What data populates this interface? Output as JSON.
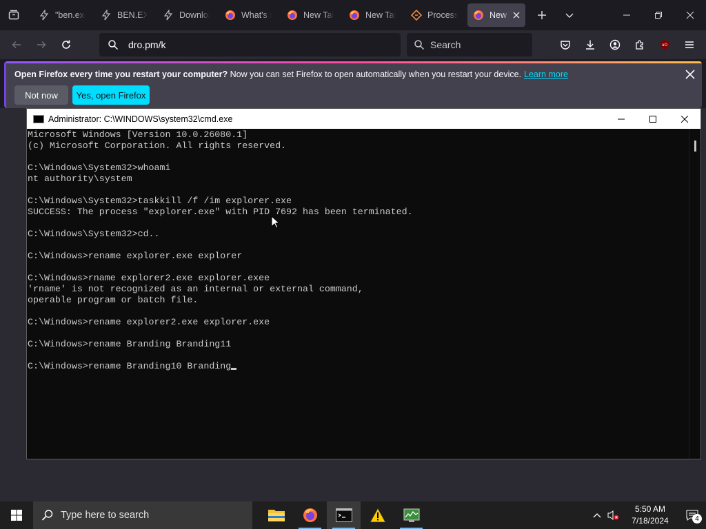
{
  "browser": {
    "tabs": [
      {
        "label": "\"ben.exe",
        "icon": "lightning-icon"
      },
      {
        "label": "BEN.EXE",
        "icon": "lightning-icon"
      },
      {
        "label": "Download",
        "icon": "lightning-icon"
      },
      {
        "label": "What's n",
        "icon": "firefox-icon"
      },
      {
        "label": "New Tab",
        "icon": "firefox-icon"
      },
      {
        "label": "New Tab",
        "icon": "firefox-icon"
      },
      {
        "label": "Process I",
        "icon": "diamond-icon"
      },
      {
        "label": "New T",
        "icon": "firefox-icon",
        "active": true
      }
    ],
    "url": "dro.pm/k",
    "search_placeholder": "Search"
  },
  "notification": {
    "bold_text": "Open Firefox every time you restart your computer?",
    "text": " Now you can set Firefox to open automatically when you restart your device.",
    "learn_more": "Learn more",
    "not_now": "Not now",
    "yes": "Yes, open Firefox"
  },
  "cmd": {
    "title": "Administrator: C:\\WINDOWS\\system32\\cmd.exe",
    "lines": [
      "Microsoft Windows [Version 10.0.26080.1]",
      "(c) Microsoft Corporation. All rights reserved.",
      "",
      "C:\\Windows\\System32>whoami",
      "nt authority\\system",
      "",
      "C:\\Windows\\System32>taskkill /f /im explorer.exe",
      "SUCCESS: The process \"explorer.exe\" with PID 7692 has been terminated.",
      "",
      "C:\\Windows\\System32>cd..",
      "",
      "C:\\Windows>rename explorer.exe explorer",
      "",
      "C:\\Windows>rname explorer2.exe explorer.exee",
      "'rname' is not recognized as an internal or external command,",
      "operable program or batch file.",
      "",
      "C:\\Windows>rename explorer2.exe explorer.exe",
      "",
      "C:\\Windows>rename Branding Branding11",
      ""
    ],
    "current_line": "C:\\Windows>rename Branding10 Branding"
  },
  "taskbar": {
    "search_placeholder": "Type here to search",
    "time": "5:50 AM",
    "date": "7/18/2024",
    "notification_count": "4"
  },
  "colors": {
    "accent": "#00ddff",
    "taskbar": "#1f1f1f",
    "console_bg": "#0c0c0c",
    "console_text": "#cccccc"
  }
}
